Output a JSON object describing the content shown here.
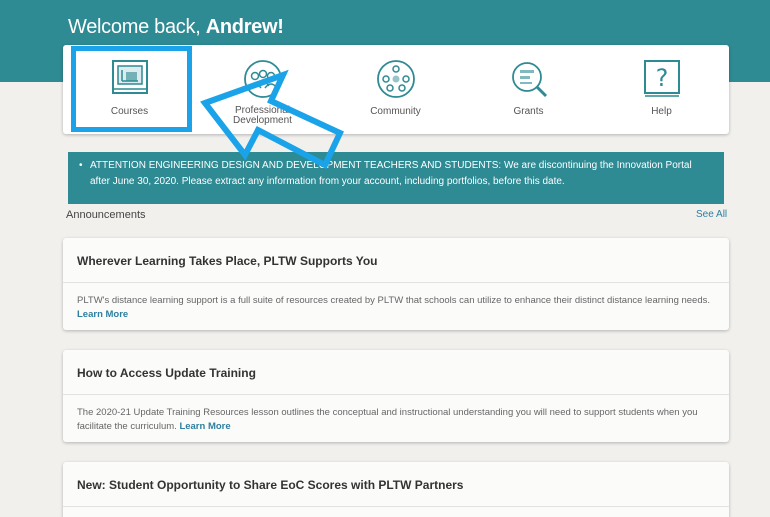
{
  "header": {
    "welcome_prefix": "Welcome back, ",
    "user_name": "Andrew!"
  },
  "nav": {
    "items": [
      {
        "label": "Courses",
        "icon": "courses-icon"
      },
      {
        "label_line1": "Professional",
        "label_line2": "Development",
        "icon": "professional-development-icon"
      },
      {
        "label": "Community",
        "icon": "community-icon"
      },
      {
        "label": "Grants",
        "icon": "grants-icon"
      },
      {
        "label": "Help",
        "icon": "help-icon"
      }
    ]
  },
  "alert": {
    "text": "ATTENTION ENGINEERING DESIGN AND DEVELOPMENT TEACHERS AND STUDENTS: We are discontinuing the Innovation Portal after June 30, 2020. Please extract any information from your account, including portfolios, before this date."
  },
  "announcements": {
    "heading": "Announcements",
    "see_all": "See All",
    "items": [
      {
        "title": "Wherever Learning Takes Place, PLTW Supports You",
        "body": "PLTW's distance learning support is a full suite of resources created by PLTW that schools can utilize to enhance their distinct distance learning needs.",
        "link": "Learn More"
      },
      {
        "title": "How to Access Update Training",
        "body": "The 2020-21 Update Training Resources lesson outlines the conceptual and instructional understanding you will need to support students when you facilitate the curriculum.",
        "link": "Learn More"
      },
      {
        "title": "New: Student Opportunity to Share EoC Scores with PLTW Partners"
      }
    ]
  },
  "colors": {
    "teal": "#2e8a93",
    "highlight": "#1aa3e8",
    "link": "#2e7fa0"
  }
}
